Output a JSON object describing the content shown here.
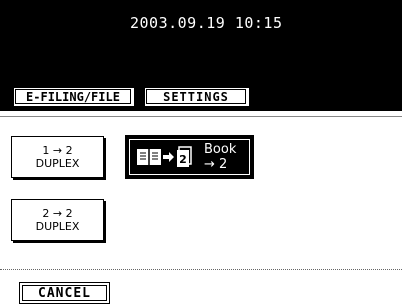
{
  "header": {
    "datetime": "2003.09.19 10:15"
  },
  "tabs": {
    "efiling_label": "E-FILING/FILE",
    "settings_label": "SETTINGS"
  },
  "modes": {
    "one_to_two": {
      "line1": "1 → 2",
      "line2": "DUPLEX"
    },
    "two_to_two": {
      "line1": "2 → 2",
      "line2": "DUPLEX"
    },
    "book": {
      "label": "Book → 2",
      "selected": true,
      "icons": [
        "open-book-icon",
        "arrow-right-icon",
        "duplex-page-icon"
      ]
    }
  },
  "footer": {
    "cancel_label": "CANCEL"
  }
}
